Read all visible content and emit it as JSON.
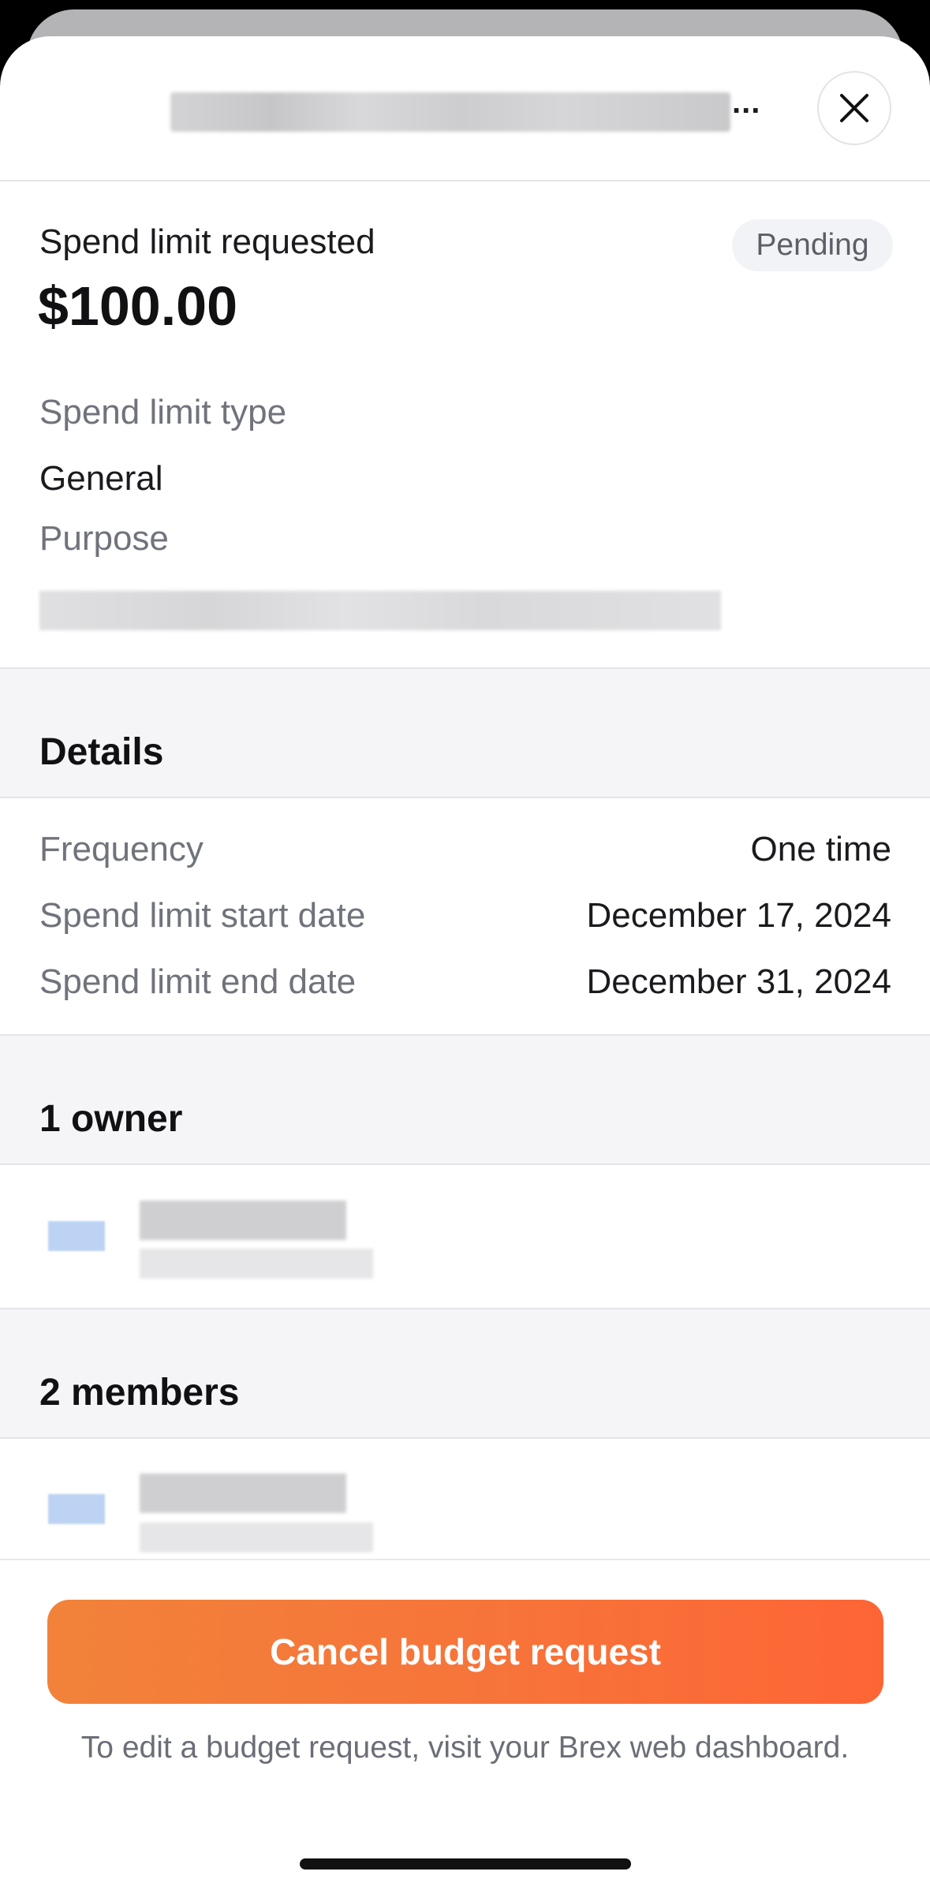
{
  "header": {
    "title_ellipsis": "...",
    "close_icon": "close-icon"
  },
  "summary": {
    "requested_label": "Spend limit requested",
    "amount": "$100.00",
    "status": "Pending",
    "type_label": "Spend limit type",
    "type_value": "General",
    "purpose_label": "Purpose"
  },
  "details": {
    "heading": "Details",
    "rows": [
      {
        "label": "Frequency",
        "value": "One time"
      },
      {
        "label": "Spend limit start date",
        "value": "December 17, 2024"
      },
      {
        "label": "Spend limit end date",
        "value": "December 31, 2024"
      }
    ]
  },
  "owners": {
    "heading": "1 owner"
  },
  "members": {
    "heading": "2 members"
  },
  "footer": {
    "cancel_label": "Cancel budget request",
    "note": "To edit a budget request, visit your Brex web dashboard."
  },
  "colors": {
    "accent_start": "#f2823a",
    "accent_end": "#fe6535",
    "section_bg": "#f5f5f8"
  }
}
